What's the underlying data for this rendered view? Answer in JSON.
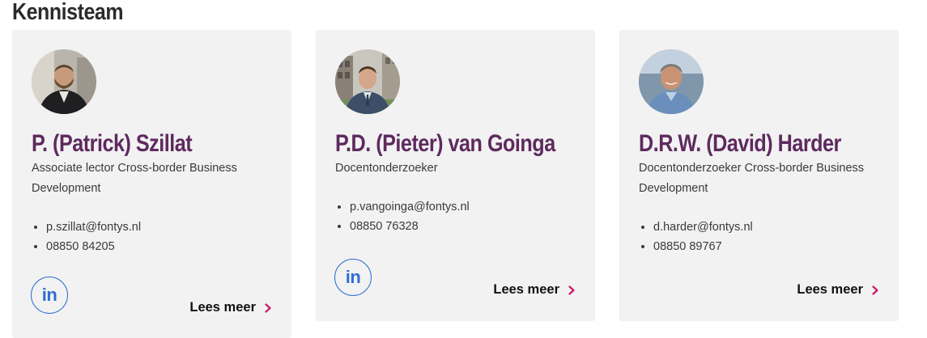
{
  "section": {
    "title": "Kennisteam"
  },
  "colors": {
    "name": "#5e2a5e",
    "accent": "#c8196e",
    "linkedin": "#2e6fd1",
    "card_bg": "#f2f2f2"
  },
  "icons": {
    "linkedin": "linkedin-icon",
    "chevron": "chevron-right-icon"
  },
  "people": [
    {
      "name": "P. (Patrick) Szillat",
      "role": "Associate lector Cross-border Business Development",
      "email": "p.szillat@fontys.nl",
      "phone": "08850 84205",
      "linkedin_label": "in",
      "more_label": "Lees meer"
    },
    {
      "name": "P.D. (Pieter) van Goinga",
      "role": "Docentonderzoeker",
      "email": "p.vangoinga@fontys.nl",
      "phone": "08850 76328",
      "linkedin_label": "in",
      "more_label": "Lees meer"
    },
    {
      "name": "D.R.W. (David) Harder",
      "role": "Docentonderzoeker Cross-border Business Development",
      "email": "d.harder@fontys.nl",
      "phone": "08850 89767",
      "more_label": "Lees meer"
    }
  ]
}
